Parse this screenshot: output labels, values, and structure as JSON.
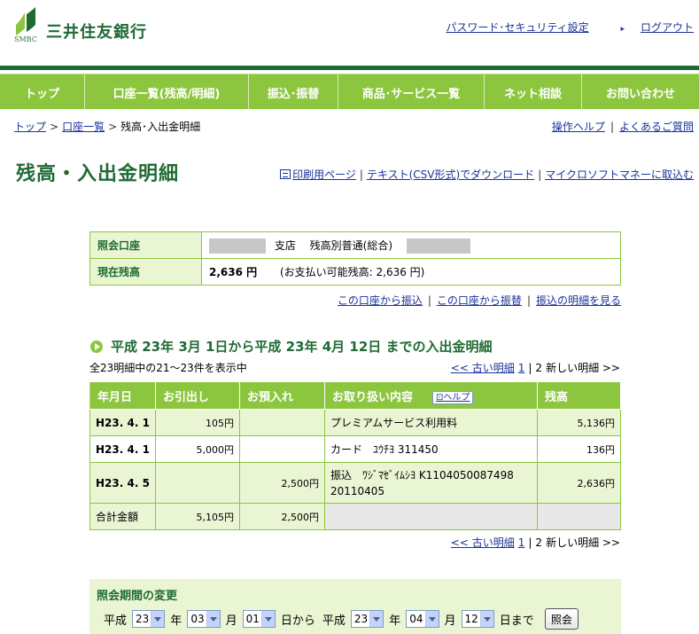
{
  "header": {
    "logo_text": "SMBC",
    "bank_name": "三井住友銀行",
    "password_link": "パスワード･セキュリティ設定",
    "logout_link": "ログアウト"
  },
  "nav": [
    "トップ",
    "口座一覧(残高/明細)",
    "振込･振替",
    "商品･サービス一覧",
    "ネット相談",
    "お問い合わせ"
  ],
  "breadcrumb": {
    "top": "トップ",
    "account_list": "口座一覧",
    "current": "残高･入出金明細"
  },
  "help_links": {
    "help": "操作ヘルプ",
    "faq": "よくあるご質問"
  },
  "page_title": "残高・入出金明細",
  "title_links": {
    "print": "印刷用ページ",
    "csv": "テキスト(CSV形式)でダウンロード",
    "money": "マイクロソフトマネーに取込む"
  },
  "account": {
    "label_account": "照会口座",
    "branch": "支店",
    "type": "残高別普通(総合)",
    "label_balance": "現在残高",
    "balance": "2,636 円",
    "available": "(お支払い可能残高: 2,636 円)"
  },
  "account_links": {
    "transfer_from": "この口座から振込",
    "transfer_switch": "この口座から振替",
    "transfer_detail": "振込の明細を見る"
  },
  "section_title": "平成 23年 3月 1日から平成 23年 4月 12日 までの入出金明細",
  "count_text": "全23明細中の21～23件を表示中",
  "pager": {
    "older": "<< 古い明細",
    "page1": "1",
    "sep": "|",
    "page2": "2",
    "newer": "新しい明細 >>"
  },
  "table": {
    "headers": [
      "年月日",
      "お引出し",
      "お預入れ",
      "お取り扱い内容",
      "残高"
    ],
    "help_label": "ヘルプ",
    "rows": [
      {
        "date": "H23. 4. 1",
        "withdraw": "105円",
        "deposit": "",
        "desc": "プレミアムサービス利用料",
        "balance": "5,136円"
      },
      {
        "date": "H23. 4. 1",
        "withdraw": "5,000円",
        "deposit": "",
        "desc": "カード　ﾕｳﾁﾖ 311450",
        "balance": "136円"
      },
      {
        "date": "H23. 4. 5",
        "withdraw": "",
        "deposit": "2,500円",
        "desc": "振込　ﾜｼﾞﾏｾﾞｲﾑｼﾖ K1104050087498 20110405",
        "balance": "2,636円"
      }
    ],
    "total": {
      "label": "合計金額",
      "withdraw": "5,105円",
      "deposit": "2,500円"
    }
  },
  "period": {
    "title": "照会期間の変更",
    "era": "平成",
    "from_year": "23",
    "from_month": "03",
    "from_day": "01",
    "to_year": "23",
    "to_month": "04",
    "to_day": "12",
    "year_label": "年",
    "month_label": "月",
    "from_label": "日から",
    "to_label": "日まで",
    "submit": "照会"
  },
  "colors": {
    "brand_green": "#1f6b34",
    "accent_green": "#8cc63f",
    "light_green": "#e9f5d3",
    "link": "#1a3399"
  }
}
